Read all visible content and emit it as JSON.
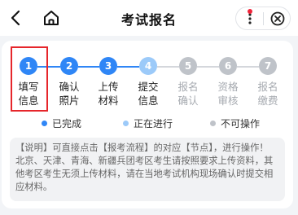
{
  "header": {
    "title": "考试报名",
    "back_icon": "chevron-left-icon",
    "home_icon": "home-icon",
    "more_icon": "more-dots-icon",
    "close_icon": "close-circle-icon",
    "notification_dot_color": "#f0243a"
  },
  "steps": [
    {
      "number": "1",
      "line1": "填写",
      "line2": "信息",
      "status": "completed"
    },
    {
      "number": "2",
      "line1": "确认",
      "line2": "照片",
      "status": "completed"
    },
    {
      "number": "3",
      "line1": "上传",
      "line2": "材料",
      "status": "completed"
    },
    {
      "number": "4",
      "line1": "提交",
      "line2": "信息",
      "status": "in_progress"
    },
    {
      "number": "5",
      "line1": "报名",
      "line2": "确认",
      "status": "disabled"
    },
    {
      "number": "6",
      "line1": "资格",
      "line2": "审核",
      "status": "disabled"
    },
    {
      "number": "7",
      "line1": "报名",
      "line2": "缴费",
      "status": "disabled"
    }
  ],
  "legend": {
    "completed": "已完成",
    "in_progress": "正在进行",
    "disabled": "不可操作"
  },
  "colors": {
    "completed": "#2f86f6",
    "in_progress": "#9ccaf9",
    "disabled": "#bfc3c9",
    "highlight": "#e6262b"
  },
  "note": {
    "text": "【说明】可直接点击【报考流程】的对应【节点】，进行操作！ 北京、天津、青海、新疆兵团考区考生请按照要求上传资料，其他考区考生无须上传材料，请在当地考试机构现场确认时提交相应材料。"
  }
}
